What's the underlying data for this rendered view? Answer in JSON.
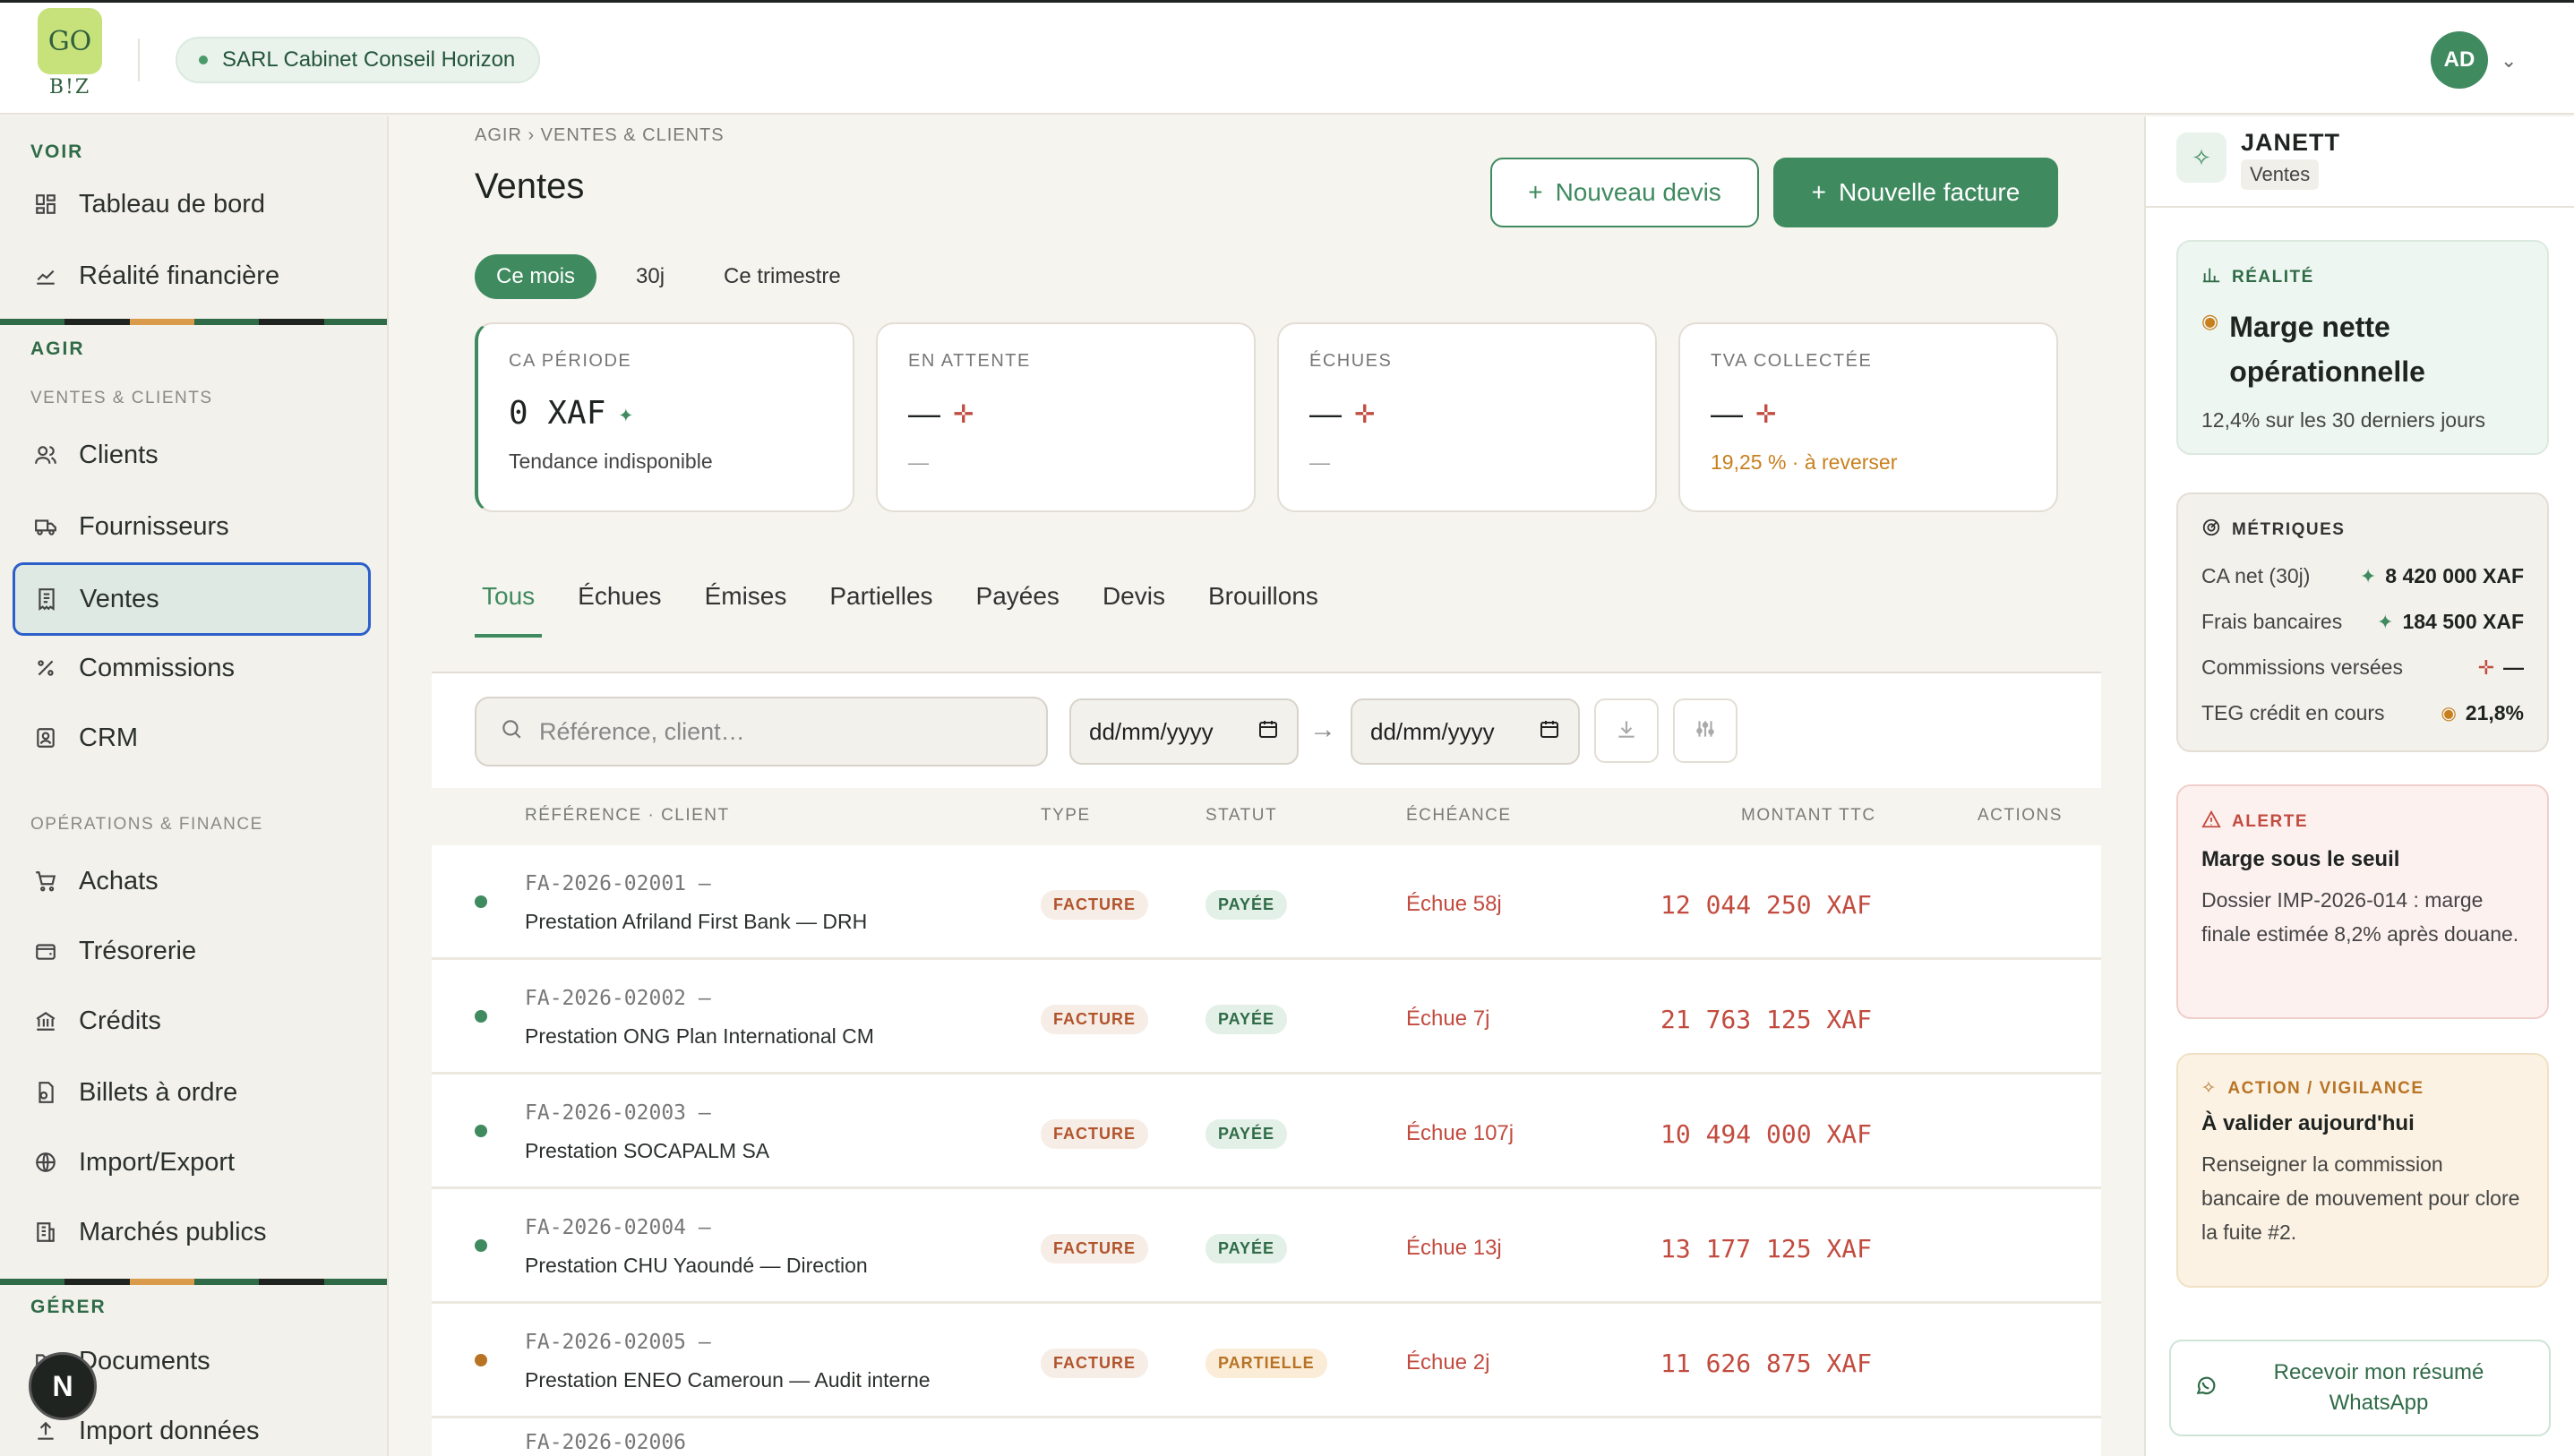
{
  "topbar": {
    "logo_text": "GO",
    "logo_sub": "B!Z",
    "company": "SARL Cabinet Conseil Horizon",
    "avatar_initials": "AD"
  },
  "sidebar": {
    "section_voir": "VOIR",
    "voir_items": [
      "Tableau de bord",
      "Réalité financière"
    ],
    "section_agir": "AGIR",
    "sub_ventes_clients": "VENTES & CLIENTS",
    "ventes_items": [
      "Clients",
      "Fournisseurs",
      "Ventes",
      "Commissions",
      "CRM"
    ],
    "sub_operations": "OPÉRATIONS & FINANCE",
    "operations_items": [
      "Achats",
      "Trésorerie",
      "Crédits",
      "Billets à ordre",
      "Import/Export",
      "Marchés publics"
    ],
    "section_gerer": "GÉRER",
    "gerer_items": [
      "Documents",
      "Import données"
    ],
    "badge": "N",
    "stripe_colors": [
      "#2f6b47",
      "#1f2421",
      "#d99a4a",
      "#2f6b47",
      "#1f2421",
      "#2f6b47"
    ]
  },
  "main": {
    "breadcrumb": "AGIR › VENTES & CLIENTS",
    "title": "Ventes",
    "btn_devis": "Nouveau devis",
    "btn_facture": "Nouvelle facture",
    "periods": [
      "Ce mois",
      "30j",
      "Ce trimestre"
    ],
    "kpis": [
      {
        "label": "CA PÉRIODE",
        "value": "0 XAF",
        "sub": "Tendance indisponible"
      },
      {
        "label": "EN ATTENTE",
        "value": "—",
        "sub": "—"
      },
      {
        "label": "ÉCHUES",
        "value": "—",
        "sub": "—"
      },
      {
        "label": "TVA COLLECTÉE",
        "value": "—",
        "sub": "19,25 % · à reverser"
      }
    ],
    "tabs": [
      "Tous",
      "Échues",
      "Émises",
      "Partielles",
      "Payées",
      "Devis",
      "Brouillons"
    ],
    "search_placeholder": "Référence, client…",
    "date_placeholder": "dd/mm/yyyy",
    "date_arrow": "→",
    "columns": [
      "RÉFÉRENCE · CLIENT",
      "TYPE",
      "STATUT",
      "ÉCHÉANCE",
      "MONTANT TTC",
      "ACTIONS"
    ],
    "rows": [
      {
        "ref": "FA-2026-02001 —",
        "client": "Prestation Afriland First Bank — DRH",
        "type": "FACTURE",
        "statut": "PAYÉE",
        "due": "Échue 58j",
        "amount": "12 044 250 XAF"
      },
      {
        "ref": "FA-2026-02002 —",
        "client": "Prestation ONG Plan International CM",
        "type": "FACTURE",
        "statut": "PAYÉE",
        "due": "Échue 7j",
        "amount": "21 763 125 XAF"
      },
      {
        "ref": "FA-2026-02003 —",
        "client": "Prestation SOCAPALM SA",
        "type": "FACTURE",
        "statut": "PAYÉE",
        "due": "Échue 107j",
        "amount": "10 494 000 XAF"
      },
      {
        "ref": "FA-2026-02004 —",
        "client": "Prestation CHU Yaoundé — Direction",
        "type": "FACTURE",
        "statut": "PAYÉE",
        "due": "Échue 13j",
        "amount": "13 177 125 XAF"
      },
      {
        "ref": "FA-2026-02005 —",
        "client": "Prestation ENEO Cameroun — Audit interne",
        "type": "FACTURE",
        "statut": "PARTIELLE",
        "due": "Échue 2j",
        "amount": "11 626 875 XAF"
      }
    ],
    "next_row_ref": "FA-2026-02006"
  },
  "assistant": {
    "name": "JANETT",
    "tag": "Ventes",
    "realite": {
      "head": "RÉALITÉ",
      "title": "Marge nette opérationnelle",
      "text": "12,4% sur les 30 derniers jours"
    },
    "metriques": {
      "head": "MÉTRIQUES",
      "items": [
        {
          "label": "CA net (30j)",
          "value": "8 420 000 XAF"
        },
        {
          "label": "Frais bancaires",
          "value": "184 500 XAF"
        },
        {
          "label": "Commissions versées",
          "value": "—"
        },
        {
          "label": "TEG crédit en cours",
          "value": "21,8%"
        }
      ]
    },
    "alerte": {
      "head": "ALERTE",
      "title": "Marge sous le seuil",
      "text": "Dossier IMP-2026-014 : marge finale estimée 8,2% après douane."
    },
    "action": {
      "head": "ACTION / VIGILANCE",
      "title": "À valider aujourd'hui",
      "text": "Renseigner la commission bancaire de mouvement pour clore la fuite #2."
    },
    "whatsapp": "Recevoir mon résumé WhatsApp"
  },
  "colors": {
    "accent": "#3f8a5f",
    "danger": "#c24b3f",
    "warning": "#c8801e",
    "focus": "#2b5fc9"
  }
}
